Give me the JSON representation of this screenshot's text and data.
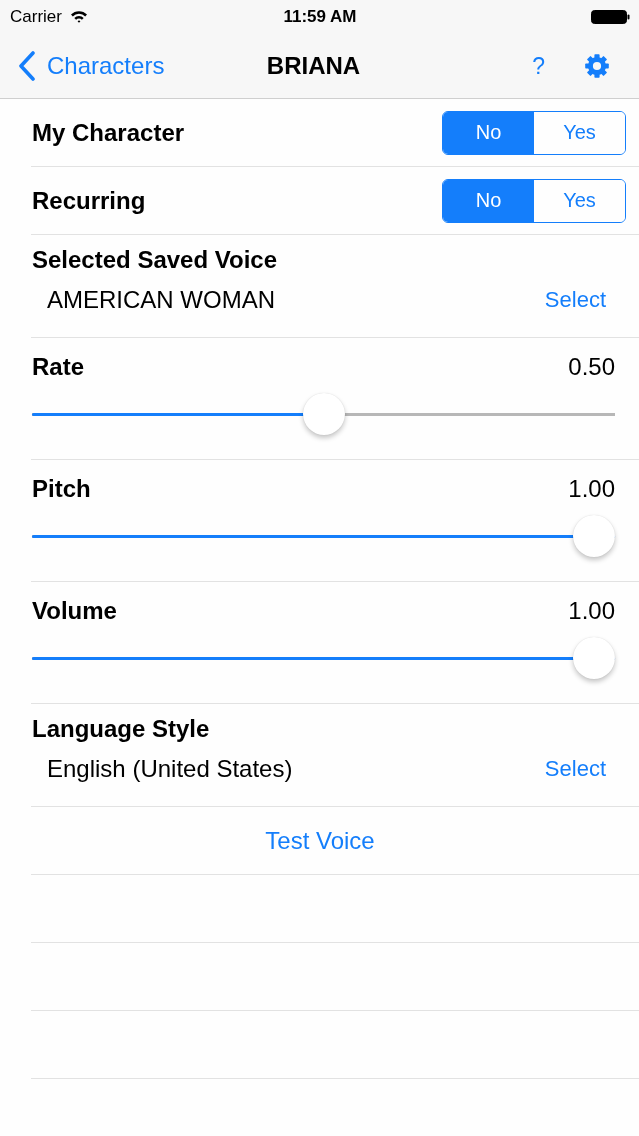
{
  "status_bar": {
    "carrier": "Carrier",
    "time": "11:59 AM"
  },
  "nav_bar": {
    "back_label": "Characters",
    "title": "BRIANA",
    "help_label": "?"
  },
  "rows": [
    {
      "kind": "segmented",
      "label": "My Character",
      "options": [
        {
          "label": "No",
          "selected": true
        },
        {
          "label": "Yes",
          "selected": false
        }
      ]
    },
    {
      "kind": "segmented",
      "label": "Recurring",
      "options": [
        {
          "label": "No",
          "selected": true
        },
        {
          "label": "Yes",
          "selected": false
        }
      ]
    },
    {
      "kind": "picker",
      "label": "Selected Saved Voice",
      "value": "AMERICAN WOMAN",
      "action": "Select"
    },
    {
      "kind": "slider",
      "label": "Rate",
      "reading": "0.50",
      "level": 0.5
    },
    {
      "kind": "slider",
      "label": "Pitch",
      "reading": "1.00",
      "level": 1
    },
    {
      "kind": "slider",
      "label": "Volume",
      "reading": "1.00",
      "level": 1
    },
    {
      "kind": "picker",
      "label": "Language Style",
      "value": "English (United States)",
      "action": "Select"
    },
    {
      "kind": "button",
      "label": "Test Voice"
    }
  ]
}
